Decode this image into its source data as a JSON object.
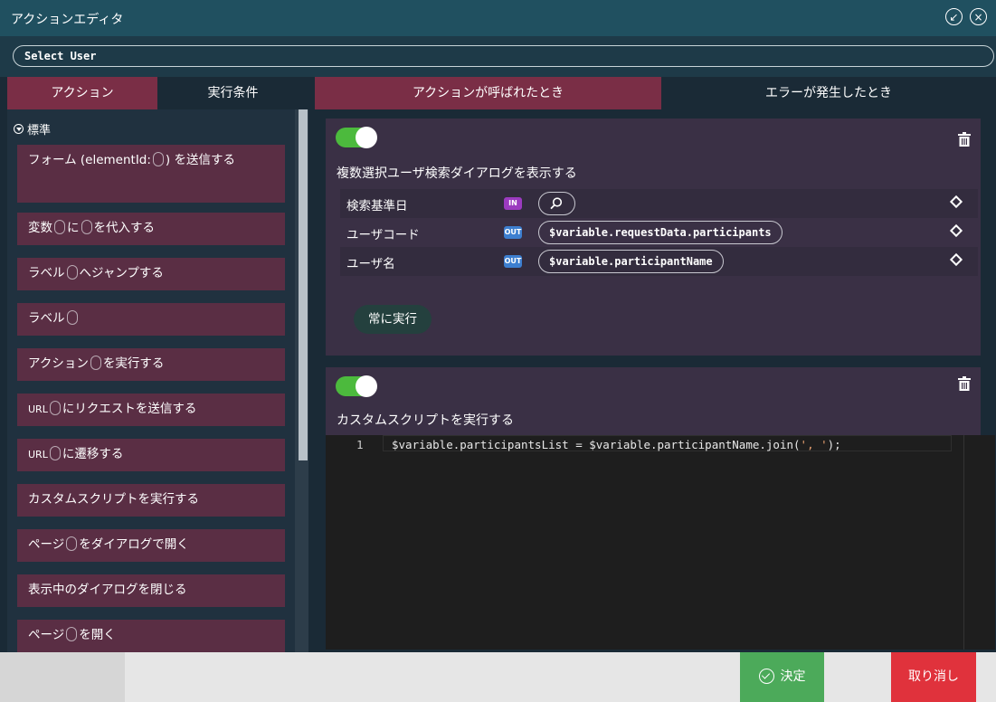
{
  "window": {
    "title": "アクションエディタ"
  },
  "user_selector": {
    "value": "Select User"
  },
  "tabs": [
    {
      "label": "アクション",
      "active": true
    },
    {
      "label": "実行条件",
      "active": false
    },
    {
      "label": "アクションが呼ばれたとき",
      "active": true
    },
    {
      "label": "エラーが発生したとき",
      "active": false
    }
  ],
  "palette": {
    "section": "標準",
    "items": [
      {
        "before": "フォーム (elementId:",
        "after": ") を送信する"
      },
      {
        "t1": "変数",
        "t2": "に",
        "t3": "を代入する"
      },
      {
        "before": "ラベル",
        "after": "へジャンプする"
      },
      {
        "before": "ラベル",
        "after": ""
      },
      {
        "before": "アクション",
        "after": "を実行する"
      },
      {
        "before": "URL",
        "after": "にリクエストを送信する"
      },
      {
        "before": "URL",
        "after": "に遷移する"
      },
      {
        "text": "カスタムスクリプトを実行する"
      },
      {
        "before": "ページ",
        "after": "をダイアログで開く"
      },
      {
        "text": "表示中のダイアログを閉じる"
      },
      {
        "before": "ページ",
        "after": "を開く"
      }
    ]
  },
  "cards": [
    {
      "enabled": true,
      "title": "複数選択ユーザ検索ダイアログを表示する",
      "params": [
        {
          "name": "検索基準日",
          "direction": "IN",
          "value": ""
        },
        {
          "name": "ユーザコード",
          "direction": "OUT",
          "value": "$variable.requestData.participants"
        },
        {
          "name": "ユーザ名",
          "direction": "OUT",
          "value": "$variable.participantName"
        }
      ],
      "condition_label": "常に実行"
    },
    {
      "enabled": true,
      "title": "カスタムスクリプトを実行する",
      "code": {
        "line_number": "1",
        "code_pre": "$variable.participantsList = $variable.participantName.join(",
        "code_str": "', '",
        "code_post": ");"
      }
    }
  ],
  "footer": {
    "ok_label": "決定",
    "cancel_label": "取り消し"
  },
  "colors": {
    "accent_tab": "#7a2e46",
    "toggle_on": "#4cba3d",
    "ok": "#4caa5a",
    "cancel": "#e0323c",
    "badge_in": "#9b3bbf",
    "badge_out": "#3d7fd0"
  }
}
